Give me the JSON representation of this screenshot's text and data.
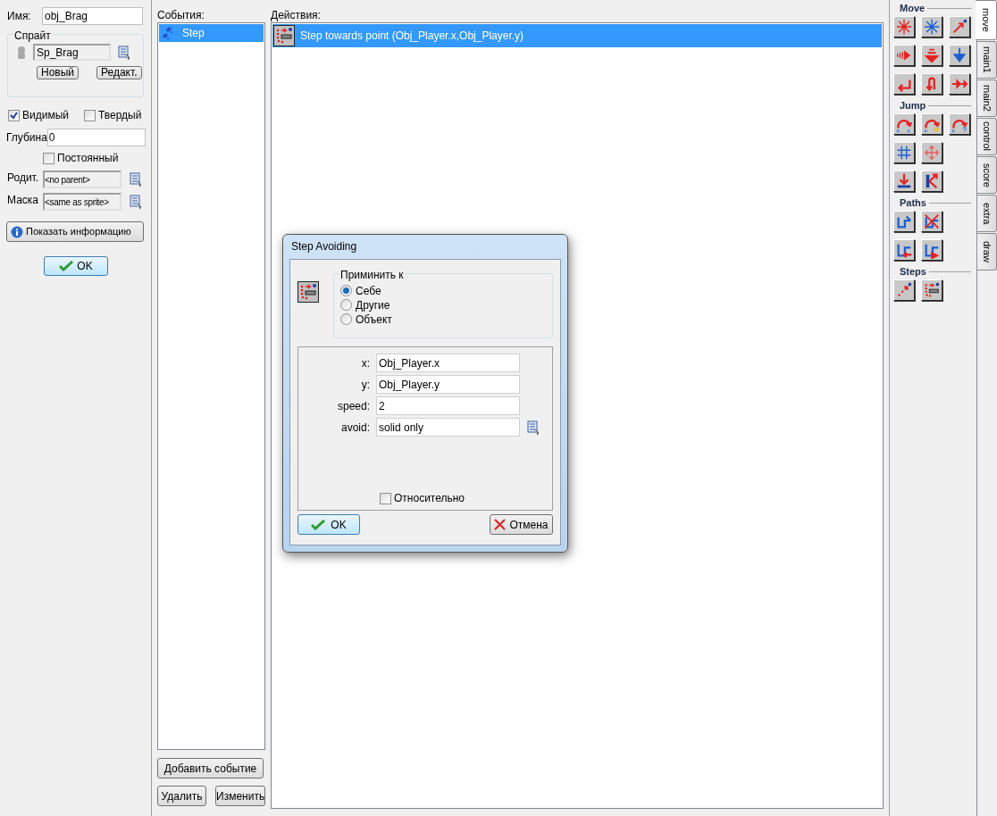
{
  "object": {
    "name_label": "Имя:",
    "name": "obj_Brag",
    "sprite": {
      "legend": "Спрайт",
      "value": "Sp_Brag",
      "buttons": [
        "Новый",
        "Редакт."
      ]
    },
    "visible": {
      "label": "Видимый",
      "checked": true
    },
    "solid": {
      "label": "Твердый",
      "checked": false
    },
    "depth": {
      "label": "Глубина",
      "value": "0"
    },
    "persistent": {
      "label": "Постоянный",
      "checked": false
    },
    "parent": {
      "label": "Родит.",
      "value": "<no parent>"
    },
    "mask": {
      "label": "Маска",
      "value": "<same as sprite>"
    },
    "info_button": "Показать информацию",
    "ok_button": "OK"
  },
  "events": {
    "label": "События:",
    "items": [
      {
        "label": "Step",
        "selected": true
      }
    ],
    "buttons": [
      "Добавить событие",
      "Удалить",
      "Изменить"
    ]
  },
  "actions": {
    "label": "Действия:",
    "items": [
      {
        "label": "Step towards point (Obj_Player.x,Obj_Player.y)",
        "selected": true
      }
    ]
  },
  "palette": {
    "groups": [
      "Move",
      "Jump",
      "Paths",
      "Steps"
    ],
    "tabs": [
      {
        "label": "move",
        "selected": true
      },
      {
        "label": "main1",
        "selected": false
      },
      {
        "label": "main2",
        "selected": false
      },
      {
        "label": "control",
        "selected": false
      },
      {
        "label": "score",
        "selected": false
      },
      {
        "label": "extra",
        "selected": false
      },
      {
        "label": "draw",
        "selected": false
      }
    ]
  },
  "dialog": {
    "title": "Step Avoiding",
    "apply_to": {
      "legend": "Приминить к",
      "options": [
        {
          "label": "Себе",
          "selected": true
        },
        {
          "label": "Другие",
          "selected": false
        },
        {
          "label": "Объект",
          "selected": false
        }
      ]
    },
    "fields": [
      {
        "label": "x:",
        "value": "Obj_Player.x"
      },
      {
        "label": "y:",
        "value": "Obj_Player.y"
      },
      {
        "label": "speed:",
        "value": "2"
      },
      {
        "label": "avoid:",
        "value": "solid only",
        "kind": "menu"
      }
    ],
    "relative": {
      "label": "Относительно",
      "checked": false
    },
    "ok": "OK",
    "cancel": "Отмена"
  }
}
